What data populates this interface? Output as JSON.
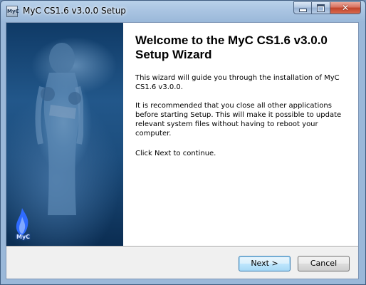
{
  "window": {
    "title": "MyC CS1.6 v3.0.0 Setup",
    "icon_label": "MyC",
    "caption_buttons": {
      "minimize": "minimize-icon",
      "maximize": "maximize-icon",
      "close": "close-icon",
      "close_glyph": "✕"
    }
  },
  "side_panel": {
    "logo_text": "MyC",
    "colors": {
      "background": "#1c4d7d",
      "flame": "#2f6bff"
    }
  },
  "content": {
    "heading": "Welcome to the MyC CS1.6 v3.0.0 Setup Wizard",
    "paragraphs": [
      "This wizard will guide you through the installation of MyC CS1.6 v3.0.0.",
      "It is recommended that you close all other applications before starting Setup. This will make it possible to update relevant system files without having to reboot your computer.",
      "Click Next to continue."
    ]
  },
  "buttons": {
    "next_label": "Next >",
    "cancel_label": "Cancel"
  },
  "colors": {
    "accent_default_button": "#3c7fb1",
    "close_button": "#c1432b",
    "frame": "#9ab8d9"
  }
}
